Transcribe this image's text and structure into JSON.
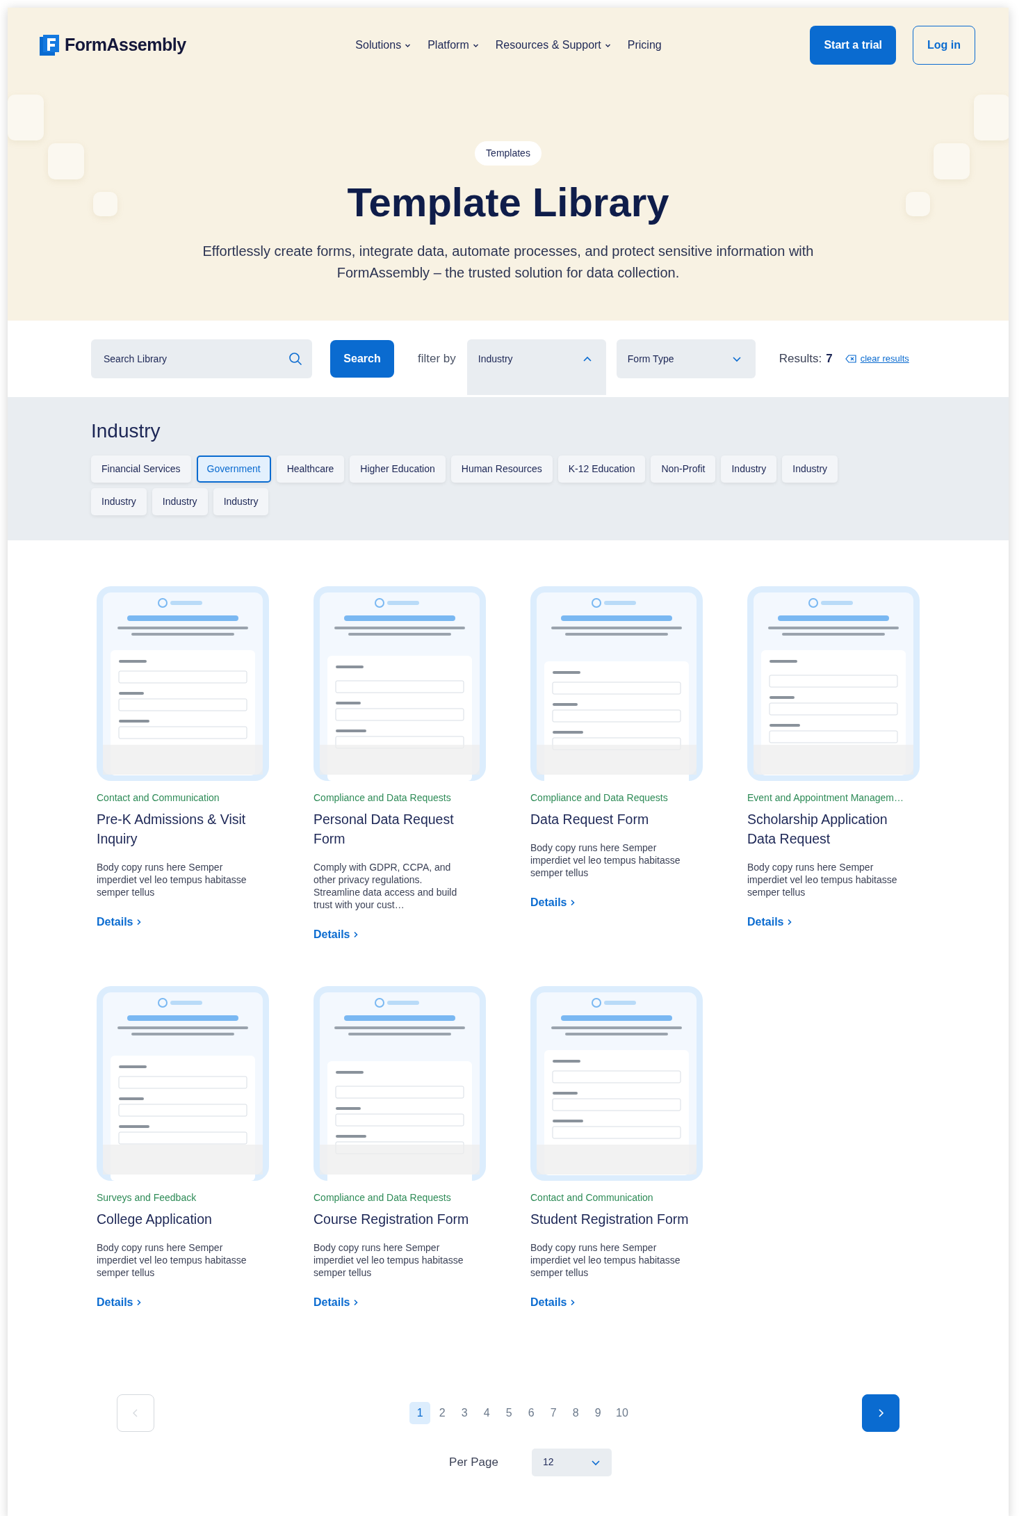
{
  "header": {
    "logo": "FormAssembly",
    "nav": [
      {
        "label": "Solutions",
        "dropdown": true
      },
      {
        "label": "Platform",
        "dropdown": true
      },
      {
        "label": "Resources & Support",
        "dropdown": true
      },
      {
        "label": "Pricing",
        "dropdown": false
      }
    ],
    "trial_button": "Start a trial",
    "login_button": "Log in"
  },
  "hero": {
    "badge": "Templates",
    "title": "Template Library",
    "subtitle": "Effortlessly create forms, integrate data, automate processes, and protect sensitive information with FormAssembly – the trusted solution for data collection."
  },
  "filter_bar": {
    "search": {
      "placeholder": "Search Library"
    },
    "search_button": "Search",
    "filter_label": "filter by",
    "dropdowns": [
      {
        "label": "Industry",
        "expanded": true
      },
      {
        "label": "Form Type",
        "expanded": false
      }
    ],
    "results_label": "Results:",
    "results_count": "7",
    "clear_link": "clear results"
  },
  "industry_panel": {
    "heading": "Industry",
    "chips": [
      {
        "label": "Financial Services",
        "selected": false
      },
      {
        "label": "Government",
        "selected": true
      },
      {
        "label": "Healthcare",
        "selected": false
      },
      {
        "label": "Higher Education",
        "selected": false
      },
      {
        "label": "Human Resources",
        "selected": false
      },
      {
        "label": "K-12 Education",
        "selected": false
      },
      {
        "label": "Non-Profit",
        "selected": false
      },
      {
        "label": "Industry",
        "selected": false
      },
      {
        "label": "Industry",
        "selected": false
      },
      {
        "label": "Industry",
        "selected": false
      },
      {
        "label": "Industry",
        "selected": false
      },
      {
        "label": "Industry",
        "selected": false
      }
    ]
  },
  "cards": [
    {
      "category": "Contact and Communication",
      "title": "Pre-K Admissions & Visit Inquiry",
      "body": "Body copy runs here Semper imperdiet vel leo tempus habitasse semper tellus",
      "link": "Details"
    },
    {
      "category": "Compliance and Data Requests",
      "title": "Personal Data Request Form",
      "body": "Comply with GDPR, CCPA, and other privacy regulations. Streamline data access and build trust with your cust…",
      "link": "Details"
    },
    {
      "category": "Compliance and Data Requests",
      "title": "Data Request Form",
      "body": "Body copy runs here Semper imperdiet vel leo tempus habitasse semper tellus",
      "link": "Details"
    },
    {
      "category": "Event and Appointment Managem…",
      "title": "Scholarship Application Data Request",
      "body": "Body copy runs here Semper imperdiet vel leo tempus habitasse semper tellus",
      "link": "Details"
    },
    {
      "category": "Surveys and Feedback",
      "title": "College Application",
      "body": "Body copy runs here Semper imperdiet vel leo tempus habitasse semper tellus",
      "link": "Details"
    },
    {
      "category": "Compliance and Data Requests",
      "title": "Course Registration Form",
      "body": "Body copy runs here Semper imperdiet vel leo tempus habitasse semper tellus",
      "link": "Details"
    },
    {
      "category": "Contact and Communication",
      "title": "Student Registration Form",
      "body": "Body copy runs here Semper imperdiet vel leo tempus habitasse semper tellus",
      "link": "Details"
    }
  ],
  "pagination": {
    "prev_disabled": true,
    "pages": [
      {
        "label": "1",
        "selected": true
      },
      {
        "label": "2",
        "selected": false
      },
      {
        "label": "3",
        "selected": false
      },
      {
        "label": "4",
        "selected": false
      },
      {
        "label": "5",
        "selected": false
      },
      {
        "label": "6",
        "selected": false
      },
      {
        "label": "7",
        "selected": false
      },
      {
        "label": "8",
        "selected": false
      },
      {
        "label": "9",
        "selected": false
      },
      {
        "label": "10",
        "selected": false
      }
    ],
    "per_page_label": "Per Page",
    "per_page_value": "12"
  }
}
